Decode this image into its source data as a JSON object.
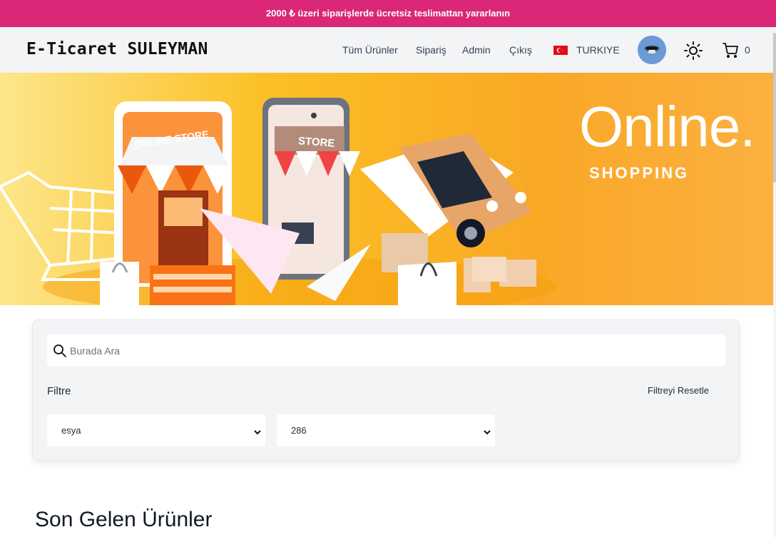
{
  "promo": {
    "text": "2000 ₺ üzeri siparişlerde ücretsiz teslimattan yararlanın"
  },
  "nav": {
    "brand": "E-Ticaret SULEYMAN",
    "links": [
      "Tüm Ürünler",
      "Sipariş",
      "Admin",
      "Çıkış"
    ],
    "country": "TURKIYE",
    "cart_count": "0"
  },
  "hero": {
    "title": "Online.",
    "subtitle": "SHOPPING",
    "store_sign": "ONLINE STORE",
    "phone_sign": "STORE"
  },
  "filters": {
    "search_placeholder": "Burada Ara",
    "label": "Filtre",
    "reset": "Filtreyi Resetle",
    "category_value": "esya",
    "price_value": "286"
  },
  "section": {
    "title": "Son Gelen Ürünler"
  },
  "colors": {
    "promo_bg": "#db2777",
    "hero_bg": "#fbbf24",
    "nav_bg": "#f3f4f6"
  }
}
